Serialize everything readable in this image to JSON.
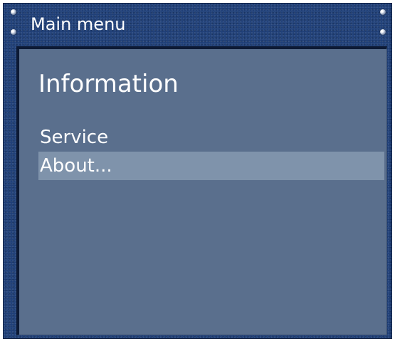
{
  "window": {
    "title": "Main menu"
  },
  "panel": {
    "heading": "Information",
    "items": [
      {
        "label": "Service",
        "selected": false
      },
      {
        "label": "About...",
        "selected": true
      }
    ]
  },
  "colors": {
    "frame": "#1f3f78",
    "panel": "#5a6f8d",
    "selection": "#7f93ab",
    "text": "#ffffff"
  }
}
